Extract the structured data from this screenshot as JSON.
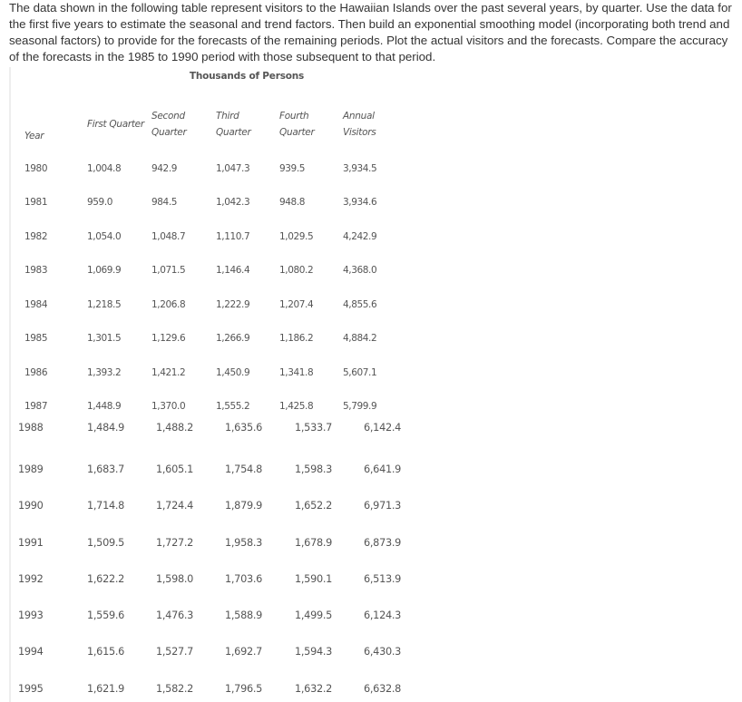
{
  "prompt": "The data shown in the following table represent visitors to the Hawaiian Islands over the past several years, by quarter. Use the data for the first five years to estimate the seasonal and trend factors. Then build an exponential smoothing model (incorporating both trend and seasonal factors) to provide for the forecasts of the remaining periods. Plot the actual visitors and the forecasts. Compare the accuracy of the forecasts in the 1985 to 1990 period with those subsequent to that period.",
  "table": {
    "caption": "Thousands of Persons",
    "headers": {
      "year": "Year",
      "q1": "First Quarter",
      "q2_line1": "Second",
      "q2_line2": "Quarter",
      "q3_line1": "Third",
      "q3_line2": "Quarter",
      "q4_line1": "Fourth",
      "q4_line2": "Quarter",
      "annual_line1": "Annual",
      "annual_line2": "Visitors"
    },
    "rows": [
      {
        "year": "1980",
        "q1": "1,004.8",
        "q2": "942.9",
        "q3": "1,047.3",
        "q4": "939.5",
        "annual": "3,934.5"
      },
      {
        "year": "1981",
        "q1": "959.0",
        "q2": "984.5",
        "q3": "1,042.3",
        "q4": "948.8",
        "annual": "3,934.6"
      },
      {
        "year": "1982",
        "q1": "1,054.0",
        "q2": "1,048.7",
        "q3": "1,110.7",
        "q4": "1,029.5",
        "annual": "4,242.9"
      },
      {
        "year": "1983",
        "q1": "1,069.9",
        "q2": "1,071.5",
        "q3": "1,146.4",
        "q4": "1,080.2",
        "annual": "4,368.0"
      },
      {
        "year": "1984",
        "q1": "1,218.5",
        "q2": "1,206.8",
        "q3": "1,222.9",
        "q4": "1,207.4",
        "annual": "4,855.6"
      },
      {
        "year": "1985",
        "q1": "1,301.5",
        "q2": "1,129.6",
        "q3": "1,266.9",
        "q4": "1,186.2",
        "annual": "4,884.2"
      },
      {
        "year": "1986",
        "q1": "1,393.2",
        "q2": "1,421.2",
        "q3": "1,450.9",
        "q4": "1,341.8",
        "annual": "5,607.1"
      },
      {
        "year": "1987",
        "q1": "1,448.9",
        "q2": "1,370.0",
        "q3": "1,555.2",
        "q4": "1,425.8",
        "annual": "5,799.9"
      },
      {
        "year": "1988",
        "q1": "1,484.9",
        "q2": "1,488.2",
        "q3": "1,635.6",
        "q4": "1,533.7",
        "annual": "6,142.4"
      },
      {
        "year": "1989",
        "q1": "1,683.7",
        "q2": "1,605.1",
        "q3": "1,754.8",
        "q4": "1,598.3",
        "annual": "6,641.9"
      },
      {
        "year": "1990",
        "q1": "1,714.8",
        "q2": "1,724.4",
        "q3": "1,879.9",
        "q4": "1,652.2",
        "annual": "6,971.3"
      },
      {
        "year": "1991",
        "q1": "1,509.5",
        "q2": "1,727.2",
        "q3": "1,958.3",
        "q4": "1,678.9",
        "annual": "6,873.9"
      },
      {
        "year": "1992",
        "q1": "1,622.2",
        "q2": "1,598.0",
        "q3": "1,703.6",
        "q4": "1,590.1",
        "annual": "6,513.9"
      },
      {
        "year": "1993",
        "q1": "1,559.6",
        "q2": "1,476.3",
        "q3": "1,588.9",
        "q4": "1,499.5",
        "annual": "6,124.3"
      },
      {
        "year": "1994",
        "q1": "1,615.6",
        "q2": "1,527.7",
        "q3": "1,692.7",
        "q4": "1,594.3",
        "annual": "6,430.3"
      },
      {
        "year": "1995",
        "q1": "1,621.9",
        "q2": "1,582.2",
        "q3": "1,796.5",
        "q4": "1,632.2",
        "annual": "6,632.8"
      }
    ]
  }
}
